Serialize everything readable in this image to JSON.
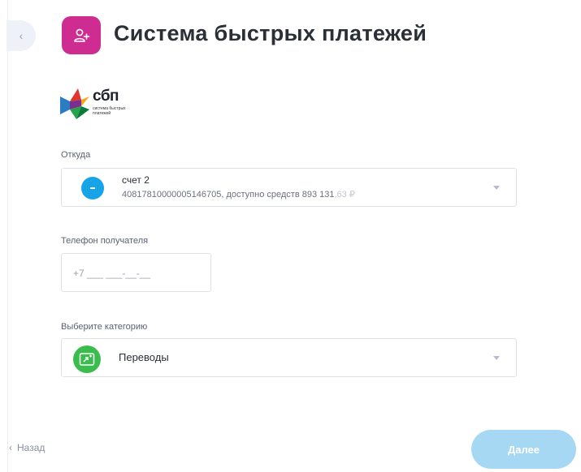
{
  "header": {
    "title": "Система быстрых платежей",
    "icon": "user-plus-icon",
    "collapse_glyph": "‹"
  },
  "logo": {
    "name": "сбп",
    "subtitle": "система быстрых платежей"
  },
  "from_field": {
    "label": "Откуда",
    "account_name": "счет 2",
    "account_detail": "40817810000005146705, доступно средств 893 131",
    "account_kopecks": ",63 ₽"
  },
  "phone_field": {
    "label": "Телефон получателя",
    "placeholder": "+7 ___ ___-__-__"
  },
  "category_field": {
    "label": "Выберите категорию",
    "value": "Переводы"
  },
  "footer": {
    "back_glyph": "‹",
    "back_label": "Назад",
    "next_label": "Далее"
  },
  "colors": {
    "accent": "#cf2c91",
    "account_icon": "#16a3e8",
    "category_icon": "#3bbd4e",
    "next_button_disabled": "#a6d8f4"
  }
}
